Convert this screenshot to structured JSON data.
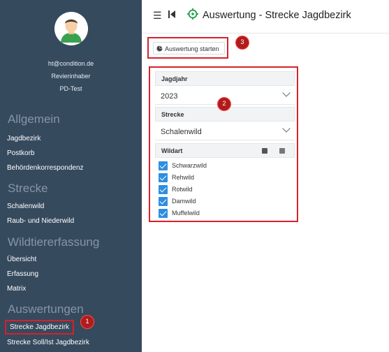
{
  "user": {
    "email": "ht@condition.de",
    "role": "Revierinhaber",
    "org": "PD-Test"
  },
  "sidebar": {
    "sections": [
      {
        "title": "Allgemein",
        "items": [
          "Jagdbezirk",
          "Postkorb",
          "Behördenkorrespondenz"
        ]
      },
      {
        "title": "Strecke",
        "items": [
          "Schalenwild",
          "Raub- und Niederwild"
        ]
      },
      {
        "title": "Wildtiererfassung",
        "items": [
          "Übersicht",
          "Erfassung",
          "Matrix"
        ]
      },
      {
        "title": "Auswertungen",
        "items": [
          "Strecke Jagdbezirk",
          "Strecke Soll/Ist Jagdbezirk"
        ]
      }
    ],
    "active_item": "Strecke Jagdbezirk"
  },
  "header": {
    "title": "Auswertung - Strecke Jagdbezirk",
    "menu_icon": "hamburger-icon",
    "collapse_icon": "collapse-sidebar-icon",
    "title_icon": "crosshair-icon"
  },
  "toolbar": {
    "start_label": "Auswertung starten",
    "start_icon": "pie-chart-icon"
  },
  "form": {
    "jagdjahr_label": "Jagdjahr",
    "jagdjahr_value": "2023",
    "strecke_label": "Strecke",
    "strecke_value": "Schalenwild",
    "wildart_label": "Wildart",
    "wildart_options": [
      {
        "label": "Schwarzwild",
        "checked": true
      },
      {
        "label": "Rehwild",
        "checked": true
      },
      {
        "label": "Rotwild",
        "checked": true
      },
      {
        "label": "Damwild",
        "checked": true
      },
      {
        "label": "Muffelwild",
        "checked": true
      }
    ]
  },
  "annotations": [
    "1",
    "2",
    "3"
  ],
  "colors": {
    "sidebar_bg": "#364a5e",
    "highlight": "#d8202a",
    "badge": "#b01c1c",
    "checkbox": "#2d8ee0",
    "accent_green": "#1f9e4b"
  }
}
